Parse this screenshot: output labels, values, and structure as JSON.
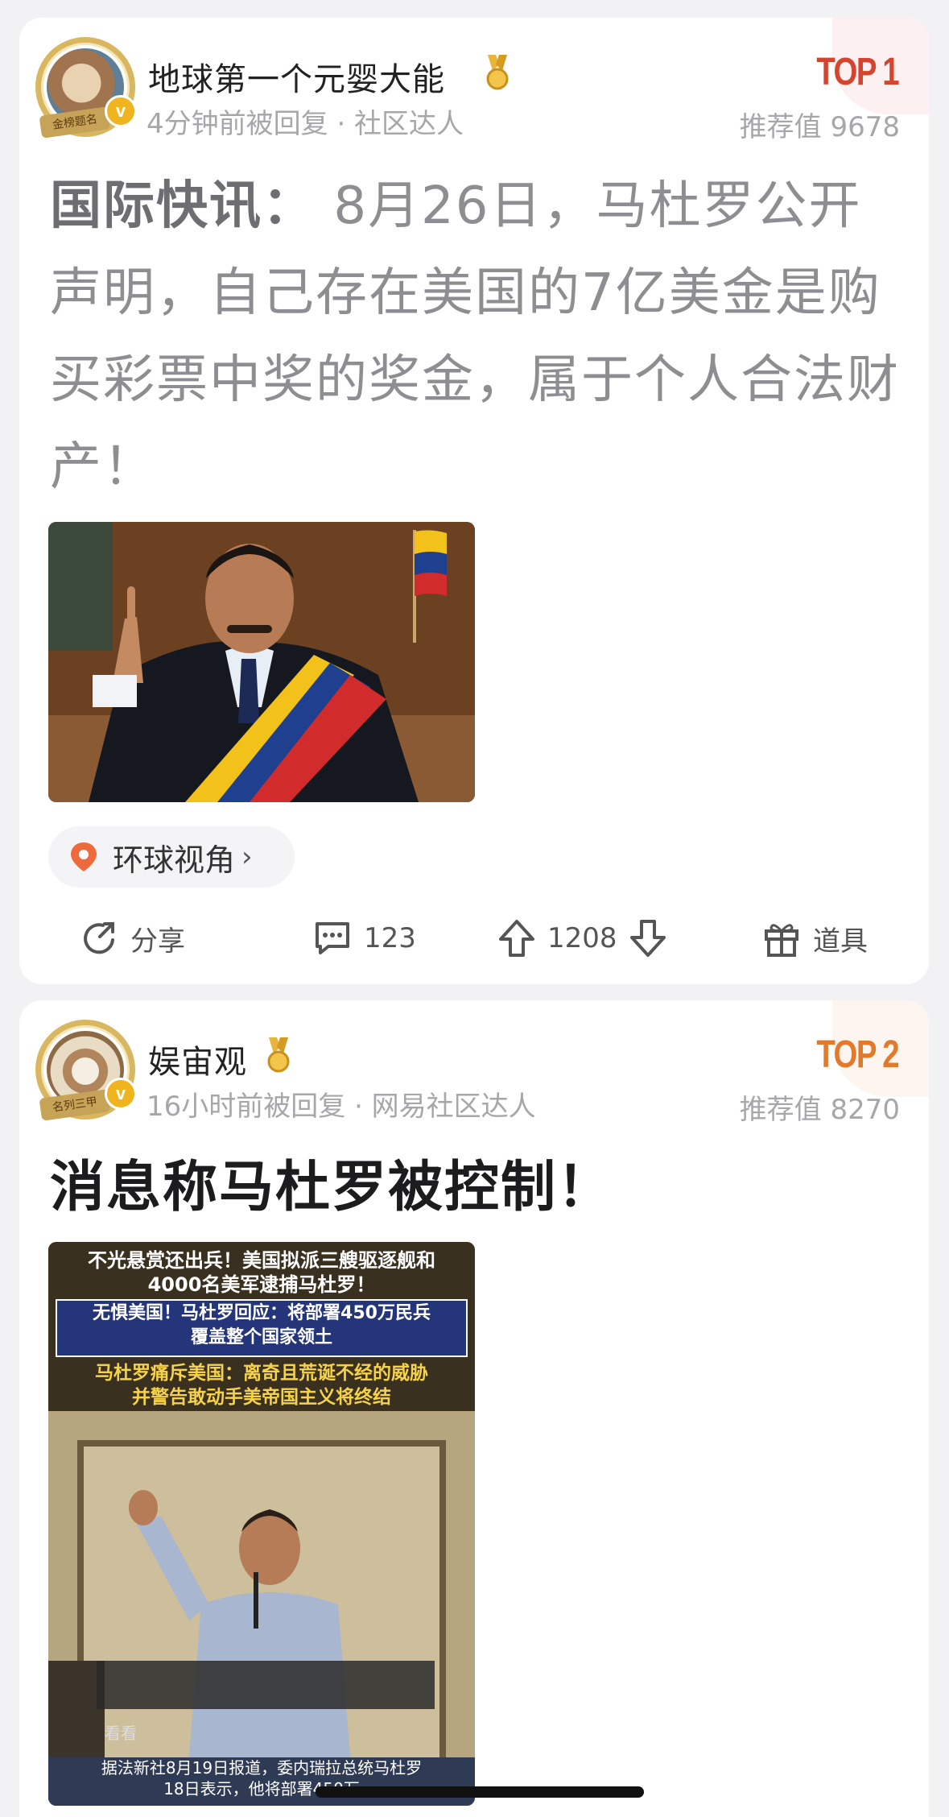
{
  "posts": [
    {
      "username": "地球第一个元婴大能",
      "avatar_ribbon": "金榜题名",
      "meta": "4分钟前被回复 · 社区达人",
      "rank": "TOP 1",
      "score": "推荐值 9678",
      "text_bold": "国际快讯：",
      "text_body": " 8月26日，马杜罗公开声明，自己存在美国的7亿美金是购买彩票中奖的奖金，属于个人合法财产！",
      "tag": "环球视角",
      "actions": {
        "share": "分享",
        "comments": "123",
        "votes": "1208",
        "props": "道具"
      }
    },
    {
      "username": "娱宙观",
      "avatar_ribbon": "名列三甲",
      "meta": "16小时前被回复 · 网易社区达人",
      "rank": "TOP 2",
      "score": "推荐值 8270",
      "title": "消息称马杜罗被控制！",
      "image_captions": {
        "line1": "不光悬赏还出兵！美国拟派三艘驱逐舰和",
        "line2": "4000名美军逮捕马杜罗！",
        "box1_line1": "无惧美国！马杜罗回应：将部署450万民兵",
        "box1_line2": "覆盖整个国家领土",
        "line3": "马杜罗痛斥美国：离奇且荒诞不经的威胁",
        "line4": "并警告敢动手美帝国主义将终结",
        "watch": "看看",
        "bottom1": "据法新社8月19日报道，委内瑞拉总统马杜罗",
        "bottom2": "18日表示，他将部署450万"
      }
    }
  ],
  "colors": {
    "top1": "#d3452e",
    "top2": "#e07a2e",
    "badge": "#f0b41e",
    "tag_pin": "#ee6a3c"
  },
  "icons": [
    "verified-badge-icon",
    "medal-icon",
    "location-pin-icon",
    "chevron-right-icon",
    "share-icon",
    "comment-icon",
    "upvote-icon",
    "downvote-icon",
    "gift-icon"
  ]
}
